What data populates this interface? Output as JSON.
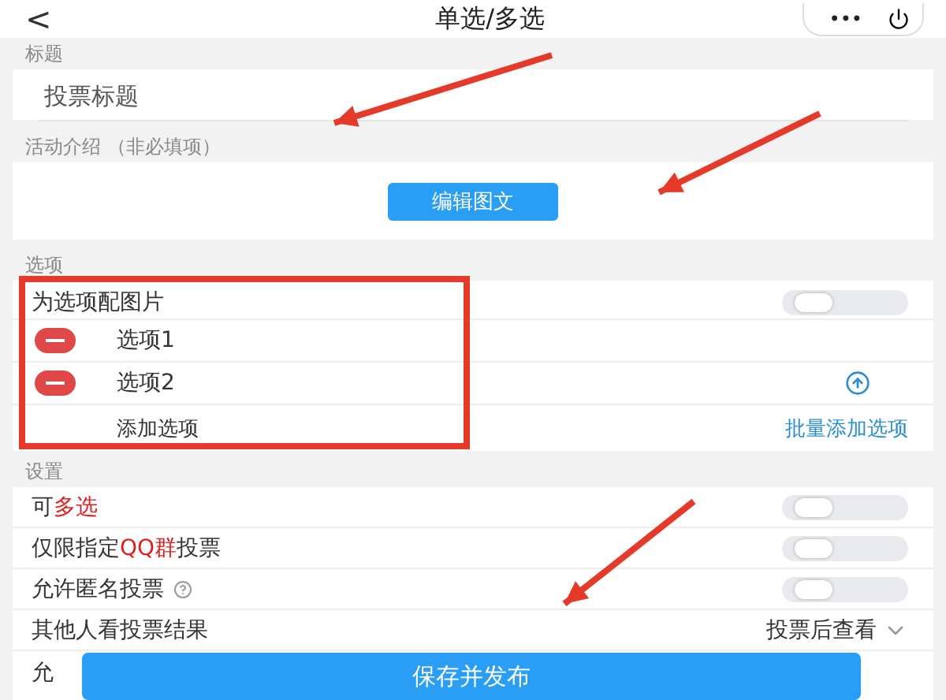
{
  "header": {
    "back": "<",
    "title": "单选/多选",
    "more": "•••"
  },
  "title_section": {
    "label": "标题",
    "placeholder": "投票标题"
  },
  "intro_section": {
    "label": "活动介绍 （非必填项）",
    "button": "编辑图文"
  },
  "options_section": {
    "label": "选项",
    "image_toggle": {
      "label": "为选项配图片",
      "on": false
    },
    "options": [
      {
        "label": "选项1",
        "sortable": false
      },
      {
        "label": "选项2",
        "sortable": true
      }
    ],
    "add": "添加选项",
    "bulk_add": "批量添加选项"
  },
  "settings_section": {
    "label": "设置",
    "rows": [
      {
        "kind": "toggle",
        "parts": [
          {
            "text": "可",
            "highlight": false
          },
          {
            "text": "多选",
            "highlight": true
          }
        ],
        "on": false
      },
      {
        "kind": "toggle",
        "parts": [
          {
            "text": "仅限指定",
            "highlight": false
          },
          {
            "text": "QQ群",
            "highlight": true
          },
          {
            "text": "投票",
            "highlight": false
          }
        ],
        "on": false
      },
      {
        "kind": "toggle",
        "parts": [
          {
            "text": "允许匿名投票",
            "highlight": false
          }
        ],
        "help": true,
        "on": false
      },
      {
        "kind": "select",
        "parts": [
          {
            "text": "其他人看投票结果",
            "highlight": false
          }
        ],
        "value": "投票后查看"
      },
      {
        "kind": "covered",
        "parts": [
          {
            "text": "允",
            "highlight": false
          }
        ]
      }
    ]
  },
  "save_button": "保存并发布"
}
